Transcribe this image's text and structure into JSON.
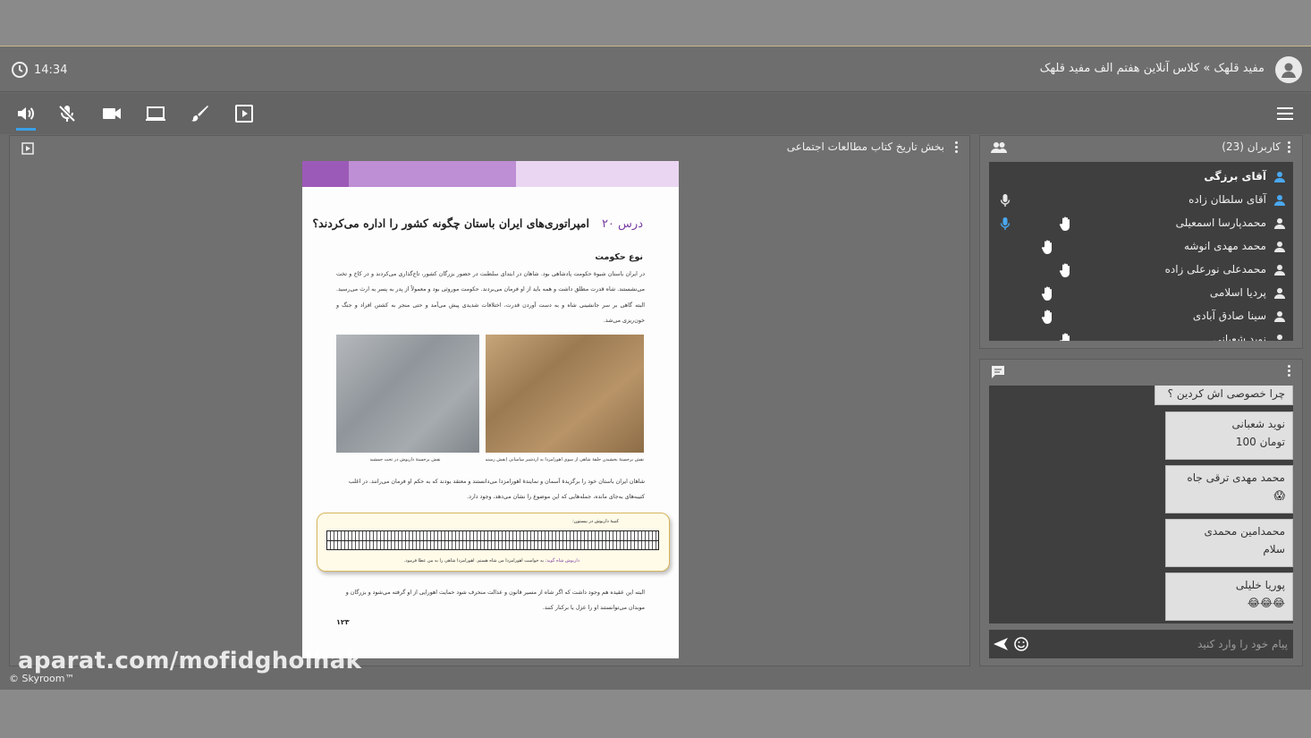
{
  "header": {
    "time": "14:34",
    "breadcrumb": "مفید قلهک » کلاس آنلاین هفتم الف مفید قلهک"
  },
  "toolbar": {
    "tools": [
      "speaker-icon",
      "mic-muted-icon",
      "camera-icon",
      "screen-share-icon",
      "brush-icon",
      "presentation-icon"
    ],
    "accent_color": "#3aa0e8"
  },
  "main": {
    "panel_title": "بخش تاریخ کتاب مطالعات اجتماعی",
    "document": {
      "band_colors": [
        "#9c5ab8",
        "#be8fd4",
        "#ead6f2"
      ],
      "lesson_number": "درس ۲۰",
      "lesson_title": "امپراتوری‌های ایران باستان چگونه کشور را اداره می‌کردند؟",
      "section_heading": "نوع حکومت",
      "paragraph1": "در ایران باستان شیوهٔ حکومت پادشاهی بود. شاهان در ابتدای سلطنت در حضور بزرگان کشور، تاج‌گذاری می‌کردند و در کاخ و تخت می‌نشستند. شاه قدرت مطلق داشت و همه باید از او فرمان می‌بردند. حکومت موروثی بود و معمولاً از پدر به پسر به ارث می‌رسید. البته گاهی بر سر جانشینی شاه و به دست آوردن قدرت، اختلافات شدیدی پیش می‌آمد و حتی منجر به کشتن افراد و جنگ و خون‌ریزی می‌شد.",
      "caption_left": "نقش برجستهٔ داریوش در تخت جمشید",
      "caption_right": "نقش برجستهٔ بخشیدن حلقهٔ شاهی از سوی اهورامزدا به اردشیر ساسانی (نقش رستم)",
      "paragraph2": "شاهان ایران باستان خود را برگزیدهٔ آسمان و نمایندهٔ اهورامزدا می‌دانستند و معتقد بودند که به حکم او فرمان می‌رانند. در اغلب کتیبه‌های به‌جای مانده، جمله‌هایی که این موضوع را نشان می‌دهد، وجود دارد.",
      "inscription_title": "کتیبهٔ داریوش در بیستون:",
      "inscription_speaker": "داریوش شاه گوید:",
      "inscription_text": "به خواست اهورامزدا من شاه هستم. اهورامزدا شاهی را به من عطا فرمود.",
      "paragraph3": "البته این عقیده هم وجود داشت که اگر شاه از مسیر قانون و عدالت منحرف شود حمایت اهورایی از او گرفته می‌شود و بزرگان و موبدان می‌توانستند او را عزل یا برکنار کنند.",
      "page_number": "۱۲۳"
    }
  },
  "users": {
    "title": "کاربران (23)",
    "list": [
      {
        "name": "آقای برزگی",
        "bold": true,
        "icon_color": "#4aa8ef",
        "mic": false,
        "hand": false
      },
      {
        "name": "آقای سلطان زاده",
        "bold": false,
        "icon_color": "#4aa8ef",
        "mic": true,
        "mic_color": "#e8e8e8",
        "hand": false
      },
      {
        "name": "محمدپارسا اسمعیلی",
        "bold": false,
        "icon_color": "#e8e8e8",
        "mic": true,
        "mic_color": "#4aa8ef",
        "hand": true
      },
      {
        "name": "محمد مهدی انوشه",
        "bold": false,
        "icon_color": "#e8e8e8",
        "mic": false,
        "hand": true
      },
      {
        "name": "محمدعلی نورعلی زاده",
        "bold": false,
        "icon_color": "#e8e8e8",
        "mic": false,
        "hand": true
      },
      {
        "name": "پردیا اسلامی",
        "bold": false,
        "icon_color": "#e8e8e8",
        "mic": false,
        "hand": true
      },
      {
        "name": "سینا صادق آبادی",
        "bold": false,
        "icon_color": "#e8e8e8",
        "mic": false,
        "hand": true
      },
      {
        "name": "نوید شعبانی",
        "bold": false,
        "icon_color": "#e8e8e8",
        "mic": false,
        "hand": true
      }
    ]
  },
  "chat": {
    "messages": [
      {
        "sender": "",
        "body": "چرا خصوصی اش کردین ؟"
      },
      {
        "sender": "نوید شعبانی",
        "body": "تومان 100"
      },
      {
        "sender": "محمد مهدی ترقی جاه",
        "body": "😱"
      },
      {
        "sender": "محمدامین محمدی",
        "body": "سلام"
      },
      {
        "sender": "پوریا خلیلی",
        "body": "😂😂😂"
      }
    ],
    "input_placeholder": "پیام خود را وارد کنید"
  },
  "watermark": "aparat.com/mofidgholhak",
  "copyright": "© Skyroom™"
}
